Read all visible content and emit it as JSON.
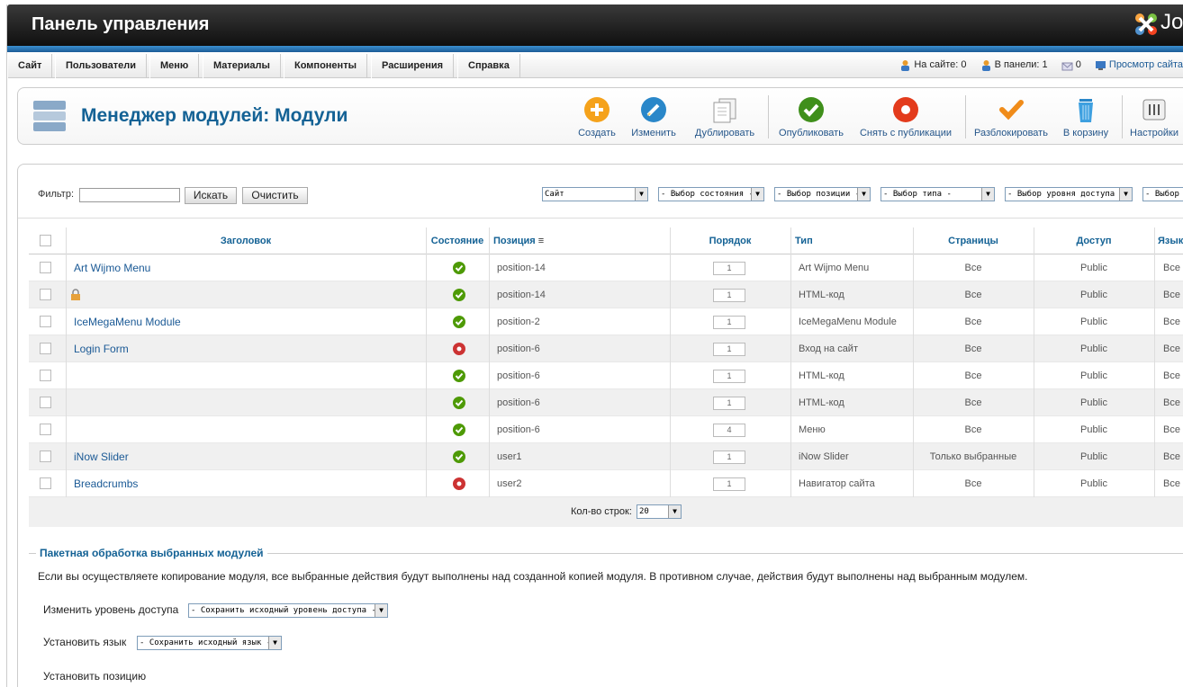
{
  "header": {
    "title": "Панель управления",
    "logo_text": "Jo"
  },
  "menu": {
    "items": [
      "Сайт",
      "Пользователи",
      "Меню",
      "Материалы",
      "Компоненты",
      "Расширения",
      "Справка"
    ]
  },
  "status": {
    "on_site": "На сайте: 0",
    "in_panel": "В панели: 1",
    "messages": "0",
    "preview": "Просмотр сайта"
  },
  "page": {
    "title": "Менеджер модулей: Модули"
  },
  "toolbar": {
    "buttons": [
      {
        "label": "Создать",
        "icon": "new-icon"
      },
      {
        "label": "Изменить",
        "icon": "edit-icon"
      },
      {
        "label": "Дублировать",
        "icon": "copy-icon"
      },
      {
        "label": "Опубликовать",
        "icon": "publish-icon"
      },
      {
        "label": "Снять с публикации",
        "icon": "unpublish-icon"
      },
      {
        "label": "Разблокировать",
        "icon": "checkin-icon"
      },
      {
        "label": "В корзину",
        "icon": "trash-icon"
      },
      {
        "label": "Настройки",
        "icon": "options-icon"
      }
    ]
  },
  "filter": {
    "label": "Фильтр:",
    "value": "",
    "search_btn": "Искать",
    "clear_btn": "Очистить",
    "selects": [
      "Сайт",
      "- Выбор состояния -",
      "- Выбор позиции -",
      "- Выбор типа -",
      "- Выбор уровня доступа -",
      "- Выбор я"
    ]
  },
  "table": {
    "headers": {
      "title": "Заголовок",
      "state": "Состояние",
      "position": "Позиция",
      "ordering": "Порядок",
      "type": "Тип",
      "pages": "Страницы",
      "access": "Доступ",
      "language": "Язык"
    },
    "rows": [
      {
        "title": "Art Wijmo Menu",
        "locked": false,
        "state": "published",
        "position": "position-14",
        "order": "1",
        "type": "Art Wijmo Menu",
        "pages": "Все",
        "access": "Public",
        "lang": "Все"
      },
      {
        "title": "",
        "locked": true,
        "state": "published",
        "position": "position-14",
        "order": "1",
        "type": "HTML-код",
        "pages": "Все",
        "access": "Public",
        "lang": "Все"
      },
      {
        "title": "IceMegaMenu Module",
        "locked": false,
        "state": "published",
        "position": "position-2",
        "order": "1",
        "type": "IceMegaMenu Module",
        "pages": "Все",
        "access": "Public",
        "lang": "Все"
      },
      {
        "title": "Login Form",
        "locked": false,
        "state": "unpublished",
        "position": "position-6",
        "order": "1",
        "type": "Вход на сайт",
        "pages": "Все",
        "access": "Public",
        "lang": "Все"
      },
      {
        "title": "",
        "locked": false,
        "state": "published",
        "position": "position-6",
        "order": "1",
        "type": "HTML-код",
        "pages": "Все",
        "access": "Public",
        "lang": "Все"
      },
      {
        "title": "",
        "locked": false,
        "state": "published",
        "position": "position-6",
        "order": "1",
        "type": "HTML-код",
        "pages": "Все",
        "access": "Public",
        "lang": "Все"
      },
      {
        "title": "",
        "locked": false,
        "state": "published",
        "position": "position-6",
        "order": "4",
        "type": "Меню",
        "pages": "Все",
        "access": "Public",
        "lang": "Все"
      },
      {
        "title": "iNow Slider",
        "locked": false,
        "state": "published",
        "position": "user1",
        "order": "1",
        "type": "iNow Slider",
        "pages": "Только выбранные",
        "access": "Public",
        "lang": "Все"
      },
      {
        "title": "Breadcrumbs",
        "locked": false,
        "state": "unpublished",
        "position": "user2",
        "order": "1",
        "type": "Навигатор сайта",
        "pages": "Все",
        "access": "Public",
        "lang": "Все"
      }
    ]
  },
  "pagination": {
    "label": "Кол-во строк:",
    "value": "20"
  },
  "batch": {
    "legend": "Пакетная обработка выбранных модулей",
    "description": "Если вы осуществляете копирование модуля, все выбранные действия будут выполнены над созданной копией модуля. В противном случае, действия будут выполнены над выбранным модулем.",
    "access_label": "Изменить уровень доступа",
    "access_value": "- Сохранить исходный уровень доступа -",
    "lang_label": "Установить язык",
    "lang_value": "- Сохранить исходный язык -",
    "position_label": "Установить позицию"
  },
  "colors": {
    "published": "#4e9a06",
    "unpublished": "#c33",
    "link": "#1a5995",
    "heading": "#146295"
  }
}
